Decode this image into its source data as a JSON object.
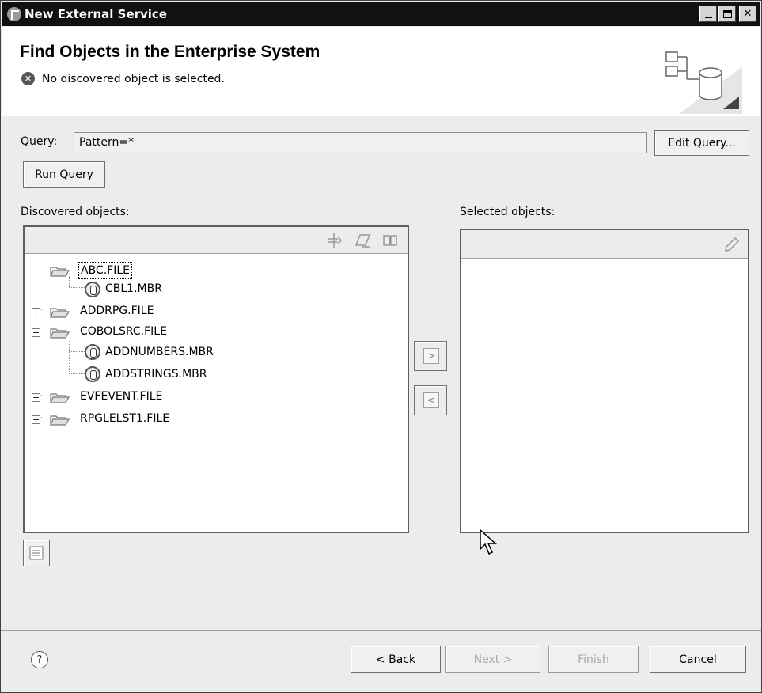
{
  "window": {
    "title": "New External Service"
  },
  "header": {
    "page_title": "Find Objects in the Enterprise System",
    "message": "No discovered object is selected."
  },
  "query": {
    "label": "Query:",
    "value": "Pattern=*",
    "edit_button": "Edit Query...",
    "run_button": "Run Query"
  },
  "discovered": {
    "label": "Discovered objects:",
    "toolbar_icons": [
      "filter-icon",
      "eraser-icon",
      "book-icon"
    ],
    "tree": [
      {
        "label": "ABC.FILE",
        "type": "folder",
        "expanded": true,
        "depth": 0,
        "focused": true
      },
      {
        "label": "CBL1.MBR",
        "type": "member",
        "depth": 1
      },
      {
        "label": "ADDRPG.FILE",
        "type": "folder",
        "expanded": false,
        "depth": 0
      },
      {
        "label": "COBOLSRC.FILE",
        "type": "folder",
        "expanded": true,
        "depth": 0
      },
      {
        "label": "ADDNUMBERS.MBR",
        "type": "member",
        "depth": 1
      },
      {
        "label": "ADDSTRINGS.MBR",
        "type": "member",
        "depth": 1
      },
      {
        "label": "EVFEVENT.FILE",
        "type": "folder",
        "expanded": false,
        "depth": 0
      },
      {
        "label": "RPGLELST1.FILE",
        "type": "folder",
        "expanded": false,
        "depth": 0
      }
    ]
  },
  "selected": {
    "label": "Selected objects:",
    "toolbar_icons": [
      "pencil-icon"
    ]
  },
  "transfer": {
    "add": ">",
    "remove": "<"
  },
  "footer": {
    "help": "?",
    "back": "Back",
    "back_prefix": "< ",
    "next": "Next >",
    "finish": "Finish",
    "cancel": "Cancel"
  }
}
